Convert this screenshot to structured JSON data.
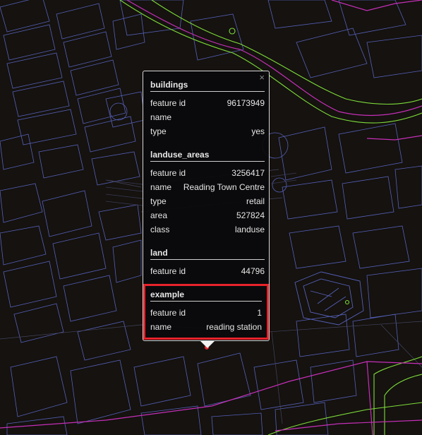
{
  "map": {
    "background": "#15120f",
    "building_color": "#5560b8",
    "parcel_color": "#4a4a66",
    "road_color": "#c62fb8",
    "green_color": "#7ddc3a"
  },
  "popup": {
    "close_label": "×",
    "sections": [
      {
        "title": "buildings",
        "rows": [
          {
            "key": "feature id",
            "value": "96173949"
          },
          {
            "key": "name",
            "value": ""
          },
          {
            "key": "type",
            "value": "yes"
          }
        ]
      },
      {
        "title": "landuse_areas",
        "rows": [
          {
            "key": "feature id",
            "value": "3256417"
          },
          {
            "key": "name",
            "value": "Reading Town Centre"
          },
          {
            "key": "type",
            "value": "retail"
          },
          {
            "key": "area",
            "value": "527824"
          },
          {
            "key": "class",
            "value": "landuse"
          }
        ]
      },
      {
        "title": "land",
        "rows": [
          {
            "key": "feature id",
            "value": "44796"
          }
        ]
      },
      {
        "title": "example",
        "highlight_color": "#e8232b",
        "rows": [
          {
            "key": "feature id",
            "value": "1"
          },
          {
            "key": "name",
            "value": "reading station"
          }
        ]
      }
    ]
  }
}
